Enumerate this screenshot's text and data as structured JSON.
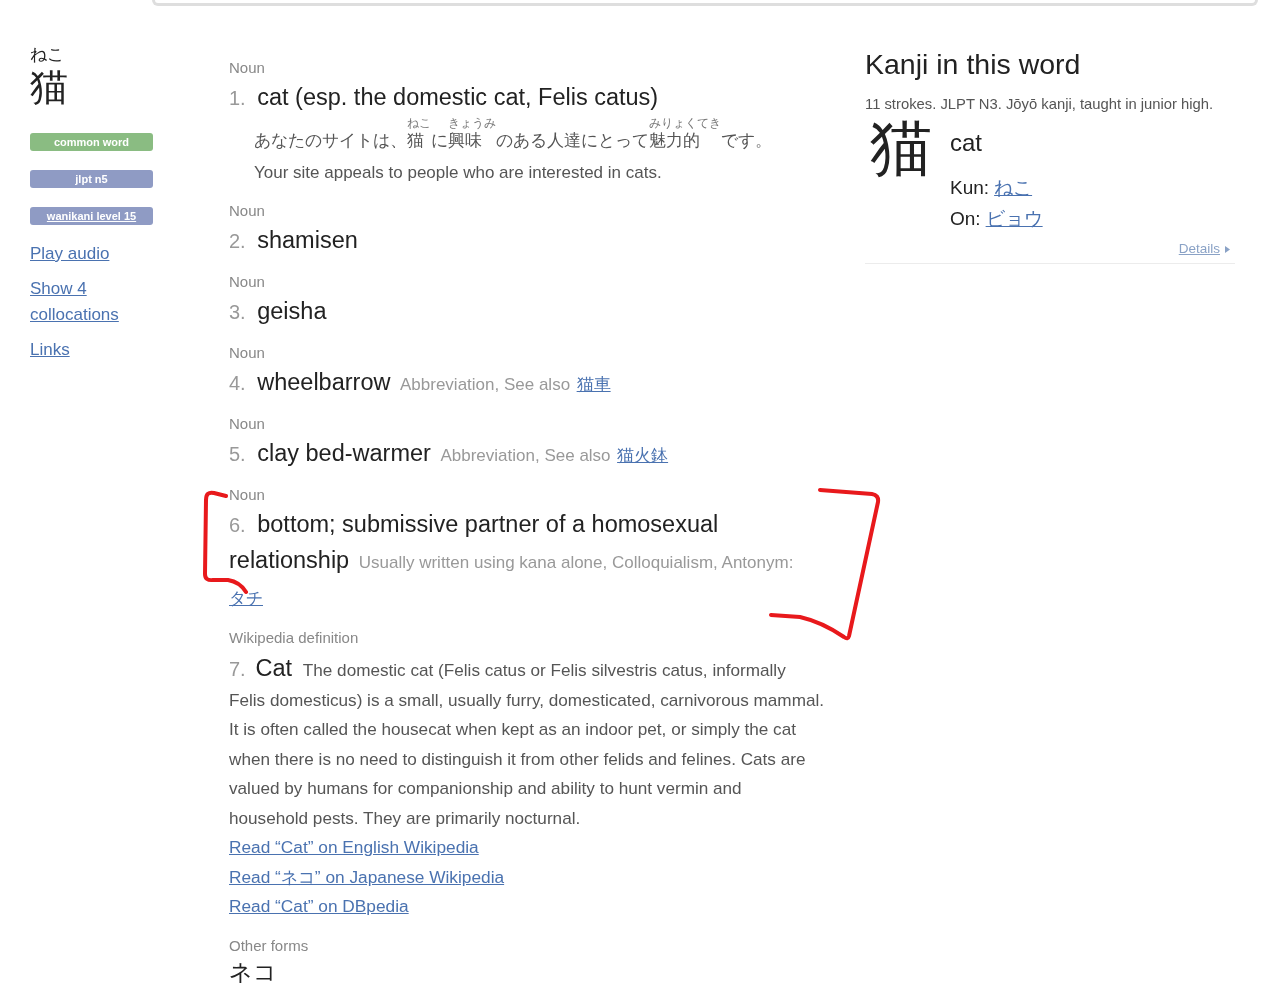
{
  "word": {
    "reading": "ねこ",
    "kanji": "猫",
    "tags": [
      {
        "label": "common word",
        "kind": "badge",
        "color": "#8abc82"
      },
      {
        "label": "jlpt n5",
        "kind": "badge",
        "color": "#8f9bc4"
      },
      {
        "label": "wanikani level 15",
        "kind": "link",
        "color": "#8f9bc4"
      }
    ],
    "links": [
      "Play audio",
      "Show 4 collocations",
      "Links"
    ]
  },
  "senses": [
    {
      "kind": "meaning",
      "pos": "Noun",
      "number": "1.",
      "meaning": "cat (esp. the domestic cat, Felis catus)",
      "example": {
        "japanese": [
          {
            "text": "あなたのサイトは、"
          },
          {
            "text": "猫",
            "reading": "ねこ"
          },
          {
            "text": "に"
          },
          {
            "text": "興味",
            "reading": "きょうみ"
          },
          {
            "text": "のある人達にとって"
          },
          {
            "text": "魅力的",
            "reading": "みりょくてき"
          },
          {
            "text": "です。"
          }
        ],
        "english": "Your site appeals to people who are interested in cats."
      }
    },
    {
      "kind": "meaning",
      "pos": "Noun",
      "number": "2.",
      "meaning": "shamisen"
    },
    {
      "kind": "meaning",
      "pos": "Noun",
      "number": "3.",
      "meaning": "geisha"
    },
    {
      "kind": "meaning",
      "pos": "Noun",
      "number": "4.",
      "meaning": "wheelbarrow",
      "info": "Abbreviation, See also",
      "link": "猫車"
    },
    {
      "kind": "meaning",
      "pos": "Noun",
      "number": "5.",
      "meaning": "clay bed-warmer",
      "info": "Abbreviation, See also",
      "link": "猫火鉢"
    },
    {
      "kind": "meaning",
      "pos": "Noun",
      "number": "6.",
      "meaning": "bottom; submissive partner of a homosexual relationship",
      "info": "Usually written using kana alone, Colloquialism, Antonym:",
      "link": "タチ"
    },
    {
      "kind": "wikipedia",
      "pos": "Wikipedia definition",
      "number": "7.",
      "meaning": "Cat",
      "description": "The domestic cat (Felis catus or Felis silvestris catus, informally Felis domesticus) is a small, usually furry, domesticated, carnivorous mammal. It is often called the housecat when kept as an indoor pet, or simply the cat when there is no need to distinguish it from other felids and felines. Cats are valued by humans for companionship and ability to hunt vermin and household pests. They are primarily nocturnal.",
      "links": [
        "Read “Cat” on English Wikipedia",
        "Read “ネコ” on Japanese Wikipedia",
        "Read “Cat” on DBpedia"
      ]
    }
  ],
  "other_forms": {
    "label": "Other forms",
    "forms": [
      "ネコ"
    ]
  },
  "kanji_panel": {
    "title": "Kanji in this word",
    "info": "11 strokes. JLPT N3. Jōyō kanji, taught in junior high.",
    "kanji": "猫",
    "meaning": "cat",
    "readings": [
      {
        "label": "Kun:",
        "values": [
          "ねこ"
        ]
      },
      {
        "label": "On:",
        "values": [
          "ビョウ"
        ]
      }
    ],
    "details": "Details"
  }
}
